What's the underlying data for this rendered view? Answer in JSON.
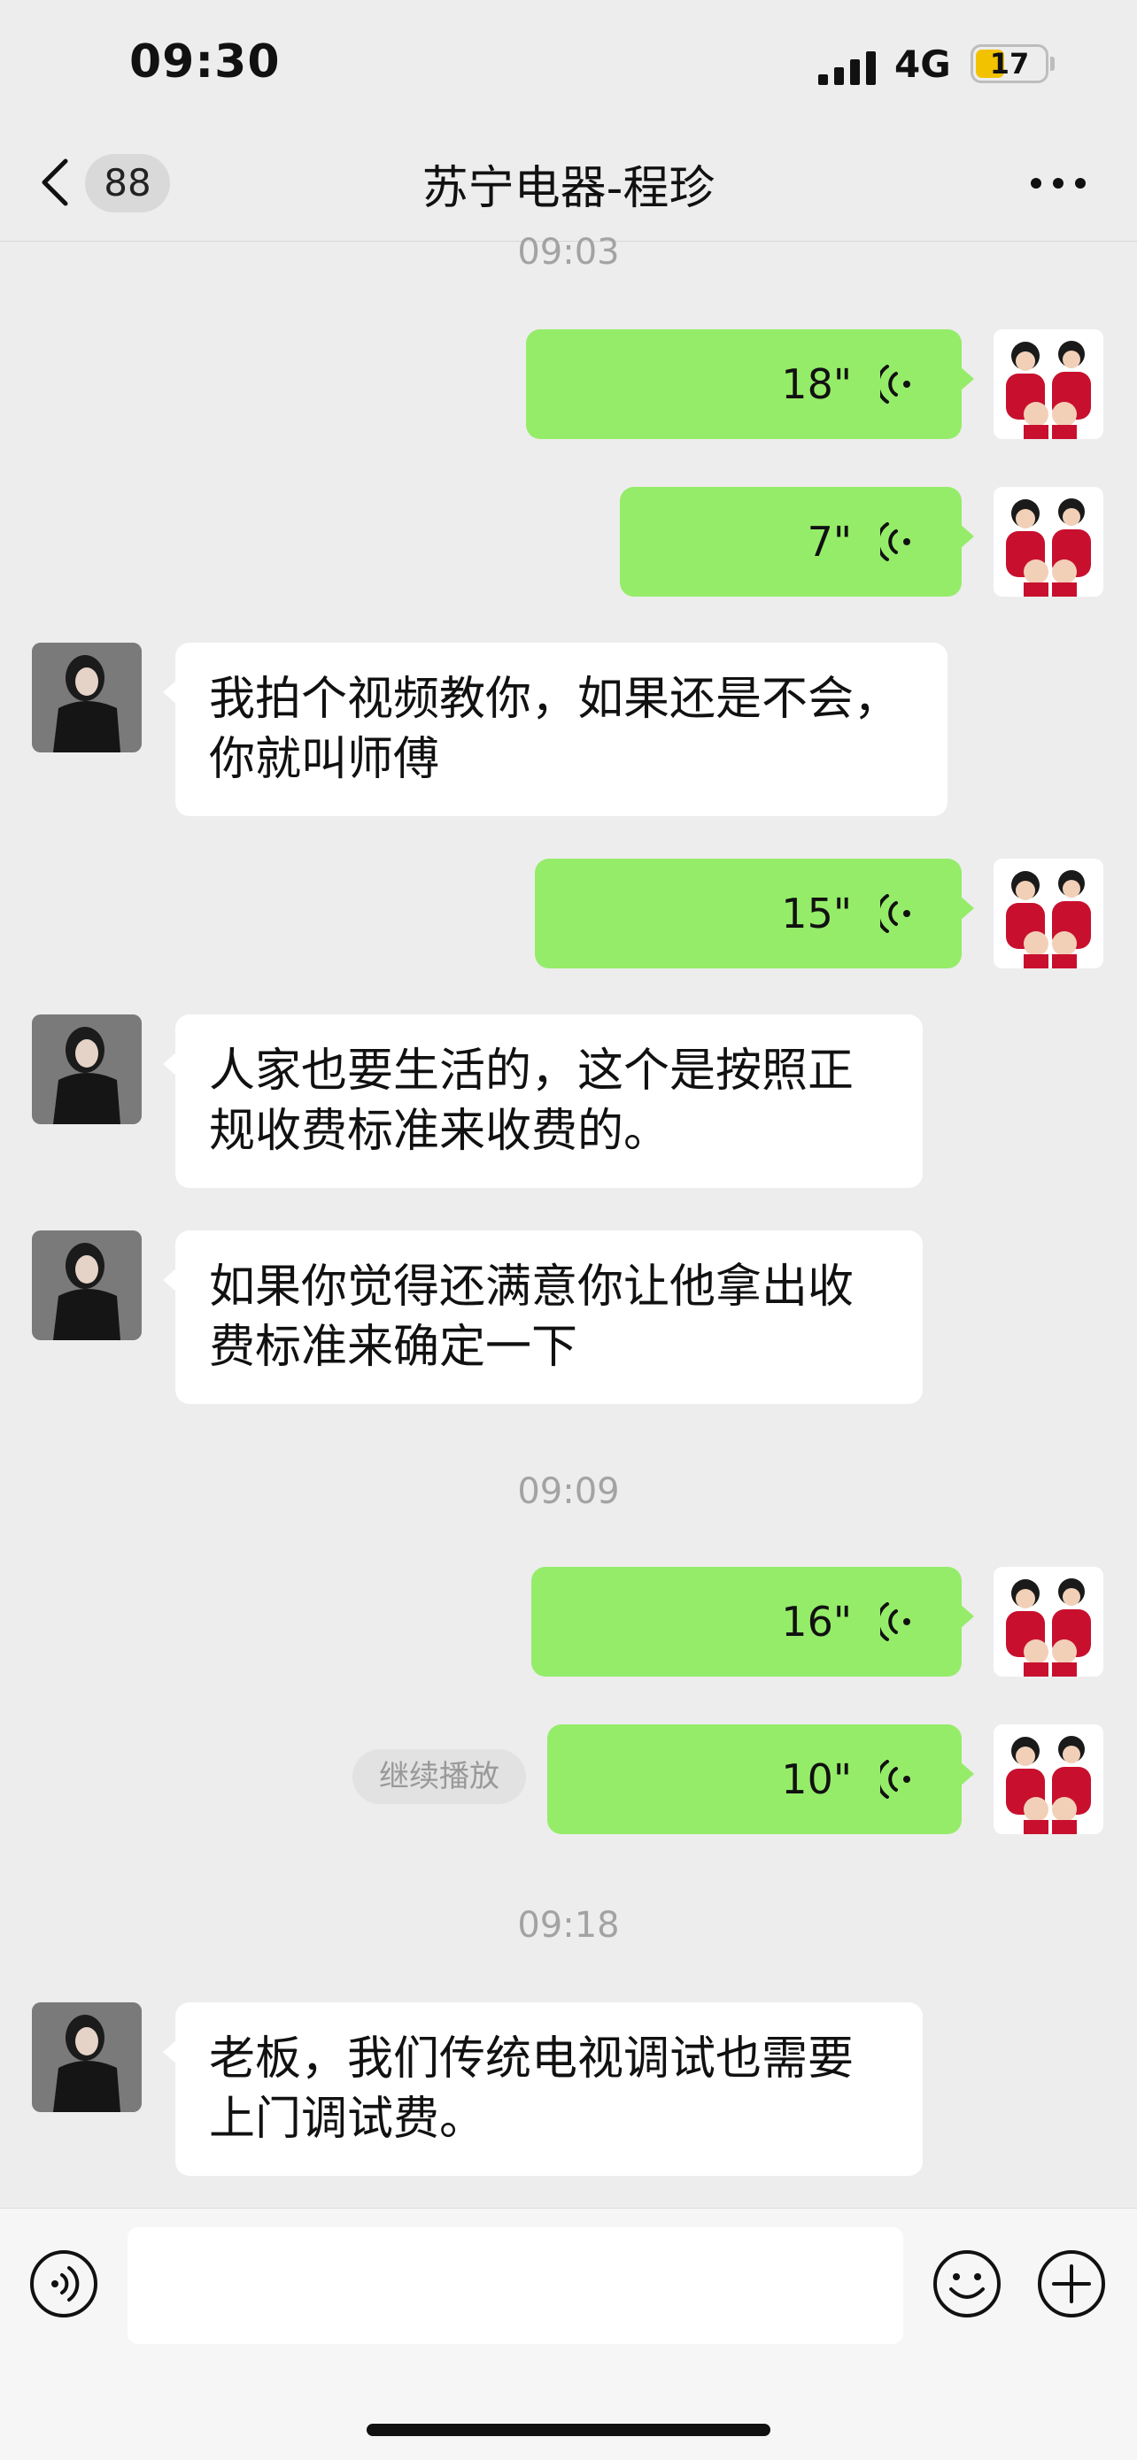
{
  "status_bar": {
    "time": "09:30",
    "network": "4G",
    "battery": "17"
  },
  "nav": {
    "unread_count": "88",
    "title": "苏宁电器-程珍"
  },
  "timestamps": [
    "09:03",
    "09:09",
    "09:18"
  ],
  "messages": [
    {
      "side": "right",
      "type": "voice",
      "duration": "18\""
    },
    {
      "side": "right",
      "type": "voice",
      "duration": "7\""
    },
    {
      "side": "left",
      "type": "text",
      "lines": [
        "我拍个视频教你，如果还是不会，",
        "你就叫师傅"
      ]
    },
    {
      "side": "right",
      "type": "voice",
      "duration": "15\""
    },
    {
      "side": "left",
      "type": "text",
      "lines": [
        "人家也要生活的，这个是按照正",
        "规收费标准来收费的。"
      ]
    },
    {
      "side": "left",
      "type": "text",
      "lines": [
        "如果你觉得还满意你让他拿出收",
        "费标准来确定一下"
      ]
    },
    {
      "side": "right",
      "type": "voice",
      "duration": "16\""
    },
    {
      "side": "right",
      "type": "voice",
      "duration": "10\""
    },
    {
      "side": "left",
      "type": "text",
      "lines": [
        "老板，我们传统电视调试也需要",
        "上门调试费。"
      ]
    }
  ],
  "continue_play": "继续播放",
  "colors": {
    "voice_bubble": "#95ec69",
    "text_bubble": "#ffffff",
    "background": "#ededed"
  },
  "icons": [
    "back-icon",
    "more-icon",
    "voice-wave-icon",
    "voice-toggle-icon",
    "emoji-icon",
    "plus-icon"
  ]
}
